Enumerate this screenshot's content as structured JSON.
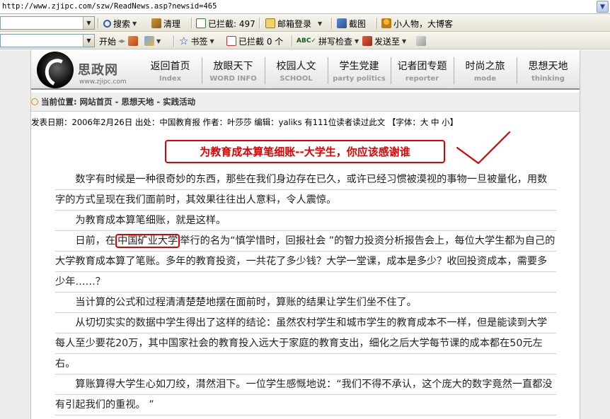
{
  "address_bar": {
    "url": "http://www.zjipc.com/szw/ReadNews.asp?newsid=465"
  },
  "toolbar1": {
    "search": "搜索",
    "clear": "清理",
    "blocked": "已拦截: 497",
    "mail_login": "邮箱登录",
    "screenshot": "截图",
    "slogan": "小人物，大博客"
  },
  "toolbar2": {
    "start": "开始",
    "bookmarks": "书签",
    "blocked": "已拦截 0 个",
    "spellcheck": "拼写检查",
    "send_to": "发送至"
  },
  "site": {
    "logo_cn": "思政网",
    "logo_url": "www.zjipc.com",
    "nav": [
      {
        "cn": "返回首页",
        "en": "Index"
      },
      {
        "cn": "放眼天下",
        "en": "WORD INFO"
      },
      {
        "cn": "校园人文",
        "en": "SCHOOL"
      },
      {
        "cn": "学生党建",
        "en": "party politics"
      },
      {
        "cn": "记者团专题",
        "en": "reporter"
      },
      {
        "cn": "时尚之旅",
        "en": "mode"
      },
      {
        "cn": "思想天地",
        "en": "thinking"
      }
    ]
  },
  "breadcrumb": {
    "label": "当前位置:",
    "path": "网站首页 - 思想天地 - 实践活动"
  },
  "meta": {
    "date": "发表日期：2006年2月26日",
    "source": "出处：中国教育报",
    "author": "作者：叶莎莎",
    "editor": "编辑：yaliks",
    "readers": "有111位读者读过此文",
    "font_size_label": "【字体：",
    "font_size_large": "大",
    "font_size_medium": "中",
    "font_size_small": "小",
    "font_size_end": "】"
  },
  "article": {
    "title": "为教育成本算笔细账--大学生，你应该感谢谁",
    "p1": "数字有时候是一种很奇妙的东西，那些在我们身边存在已久，或许已经习惯被漠视的事物一旦被量化，用数字的方式呈现在我们面前时，其效果往往出人意料，令人震惊。",
    "p2": "为教育成本算笔细账，就是这样。",
    "p3_pre": "日前，在",
    "p3_highlight": "中国矿业大学",
    "p3_post": "举行的名为“慎学惜时，回报社会 ”的智力投资分析报告会上，每位大学生都为自己的大学教育成本算了笔账。多年的教育投资，一共花了多少钱？大学一堂课，成本是多少？收回投资成本，需要多少年……？",
    "p4": "当计算的公式和过程清清楚楚地摆在面前时，算账的结果让学生们坐不住了。",
    "p5": "从切切实实的数据中学生得出了这样的结论：虽然农村学生和城市学生的教育成本不一样，但是能读到大学每人至少要花20万，其中国家社会的教育投入远大于家庭的教育支出，细化之后大学每节课的成本都在50元左右。",
    "p6": "算账算得大学生心如刀绞，潸然泪下。一位学生感慨地说：“我们不得不承认，这个庞大的数字竟然一直都没有引起我们的重视。 ”"
  },
  "colors": {
    "accent_red": "#e00000",
    "breadcrumb_dot": "#e08a00"
  }
}
